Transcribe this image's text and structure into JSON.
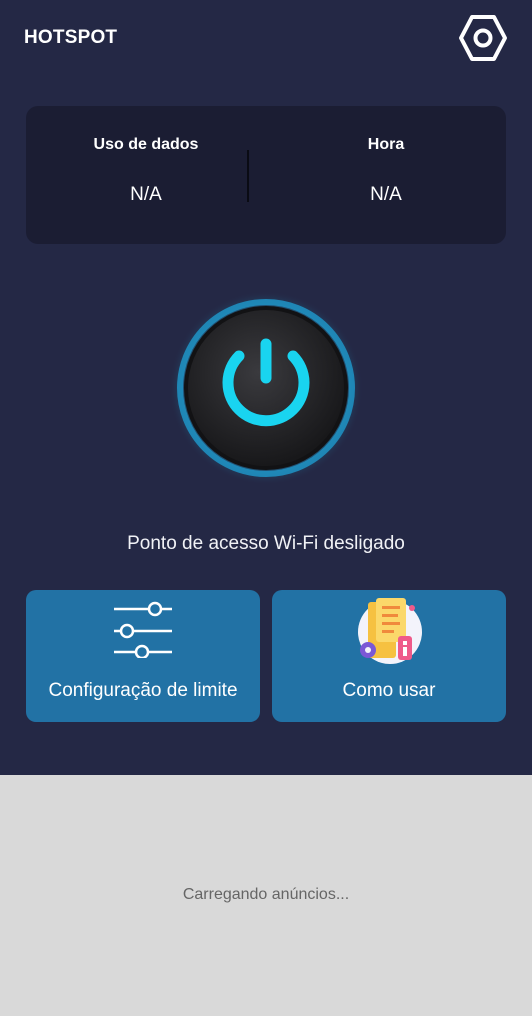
{
  "header": {
    "title": "HOTSPOT",
    "settings_icon": "settings-hexagon-icon"
  },
  "stats": {
    "data_usage": {
      "label": "Uso de dados",
      "value": "N/A"
    },
    "time": {
      "label": "Hora",
      "value": "N/A"
    }
  },
  "power": {
    "icon": "power-icon",
    "accent_color": "#19d4f0"
  },
  "status": {
    "text": "Ponto de acesso Wi-Fi desligado"
  },
  "actions": {
    "limit_config": {
      "label": "Configuração de limite",
      "icon": "sliders-icon"
    },
    "how_to_use": {
      "label": "Como usar",
      "icon": "guide-illustration-icon"
    }
  },
  "ads": {
    "loading_text": "Carregando anúncios..."
  },
  "colors": {
    "background": "#242845",
    "card": "#1b1d33",
    "button": "#2272a5",
    "ad_background": "#d9d9d9"
  }
}
